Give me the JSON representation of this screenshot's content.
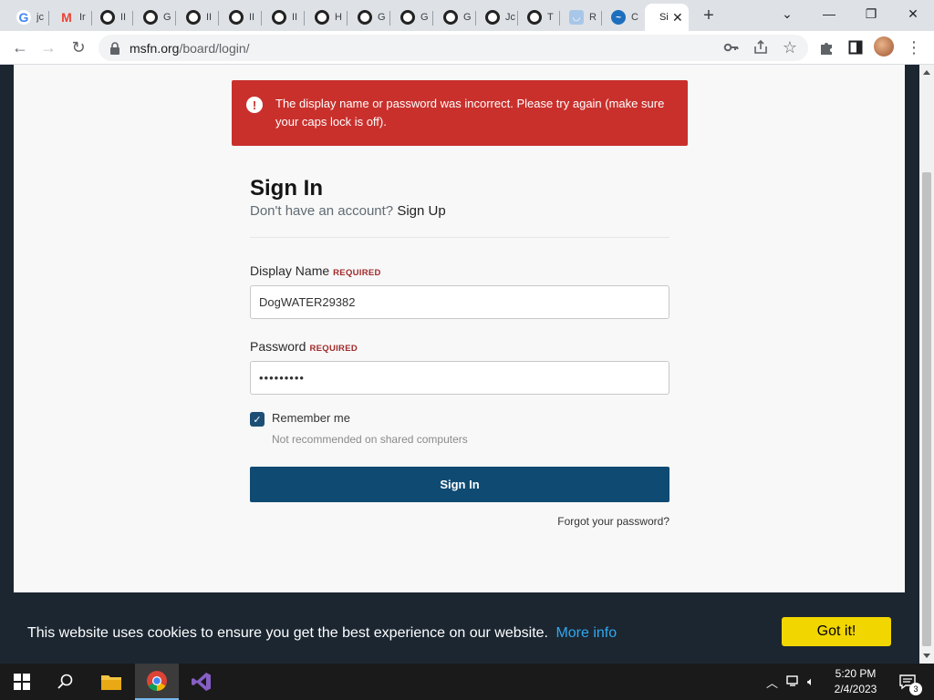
{
  "browser": {
    "tabs": [
      {
        "title": "jc",
        "icon": "google-icon"
      },
      {
        "title": "Ir",
        "icon": "gmail-icon"
      },
      {
        "title": "II",
        "icon": "site-icon"
      },
      {
        "title": "G",
        "icon": "site-icon"
      },
      {
        "title": "II",
        "icon": "site-icon"
      },
      {
        "title": "II",
        "icon": "site-icon"
      },
      {
        "title": "II",
        "icon": "site-icon"
      },
      {
        "title": "H",
        "icon": "site-icon"
      },
      {
        "title": "G",
        "icon": "site-icon"
      },
      {
        "title": "G",
        "icon": "site-icon"
      },
      {
        "title": "G",
        "icon": "site-icon"
      },
      {
        "title": "Jc",
        "icon": "site-icon"
      },
      {
        "title": "T",
        "icon": "site-icon"
      },
      {
        "title": "R",
        "icon": "site-icon"
      },
      {
        "title": "C",
        "icon": "site-icon"
      },
      {
        "title": "Si",
        "icon": "site-icon",
        "active": true
      }
    ],
    "url_host": "msfn.org",
    "url_path": "/board/login/"
  },
  "error": {
    "message": "The display name or password was incorrect. Please try again (make sure your caps lock is off)."
  },
  "signin": {
    "title": "Sign In",
    "no_account": "Don't have an account?",
    "signup_link": "Sign Up",
    "display_name_label": "Display Name",
    "display_name_required": "REQUIRED",
    "display_name_value": "DogWATER29382",
    "password_label": "Password",
    "password_required": "REQUIRED",
    "password_value": "•••••••••",
    "remember_label": "Remember me",
    "remember_checked": true,
    "remember_hint": "Not recommended on shared computers",
    "submit_label": "Sign In",
    "forgot_link": "Forgot your password?"
  },
  "cookie_banner": {
    "text": "This website uses cookies to ensure you get the best experience on our website.",
    "more_link": "More info",
    "accept_label": "Got it!"
  },
  "taskbar": {
    "time": "5:20 PM",
    "date": "2/4/2023",
    "notification_count": "3"
  },
  "colors": {
    "error_bg": "#c9302c",
    "signin_button": "#0f4a73",
    "cookie_accept": "#f1d600",
    "page_dark": "#1b2631"
  }
}
